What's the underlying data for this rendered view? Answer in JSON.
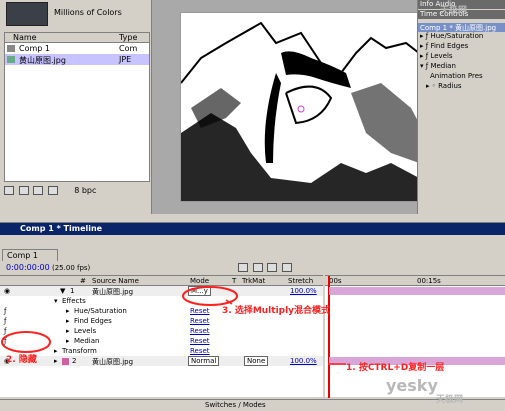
{
  "project": {
    "color_info": "Millions of Colors",
    "col_name": "Name",
    "col_type": "Type",
    "items": [
      {
        "name": "Comp 1",
        "type": "Com"
      },
      {
        "name": "黄山原图.jpg",
        "type": "JPE"
      }
    ],
    "bpc": "8 bpc"
  },
  "effects_panel": {
    "top_tabs": "Info  Audio",
    "time_controls": "Time Controls",
    "comp_layer": "Comp 1 * 黄山原图.jpg",
    "items": [
      "Hue/Saturation",
      "Find Edges",
      "Levels",
      "Median"
    ],
    "animation_presets": "Animation Pres",
    "radius": "Radius"
  },
  "timeline": {
    "title": "Comp 1 * Timeline",
    "tab": "Comp 1",
    "timecode": "0:00:00:00",
    "fps": "(25.00 fps)",
    "headers": {
      "num": "#",
      "source": "Source Name",
      "mode": "Mode",
      "t": "T",
      "trkmat": "TrkMat",
      "stretch": "Stretch"
    },
    "ruler": {
      "start": "00s",
      "end": "00:15s"
    },
    "layers": [
      {
        "num": "1",
        "name": "黄山原图.jpg",
        "mode": "M...y",
        "stretch": "100.0%"
      },
      {
        "num": "2",
        "name": "黄山原图.jpg",
        "mode": "Normal",
        "trkmat": "None",
        "stretch": "100.0%"
      }
    ],
    "effects_label": "Effects",
    "effects": [
      "Hue/Saturation",
      "Find Edges",
      "Levels",
      "Median"
    ],
    "reset_label": "Reset",
    "transform_label": "Transform",
    "switches_modes": "Switches / Modes"
  },
  "annotations": {
    "a1": "1. 按CTRL+D复制一层",
    "a2": "2. 隐藏",
    "a3": "3. 选择Multiply混合模式"
  },
  "watermarks": {
    "w1": "天极网",
    "w2": "yesky",
    "w3": "天极网"
  },
  "colors": {
    "accent": "#0a246a",
    "annotation": "#ff2020",
    "bar": "#d9a6d9"
  }
}
